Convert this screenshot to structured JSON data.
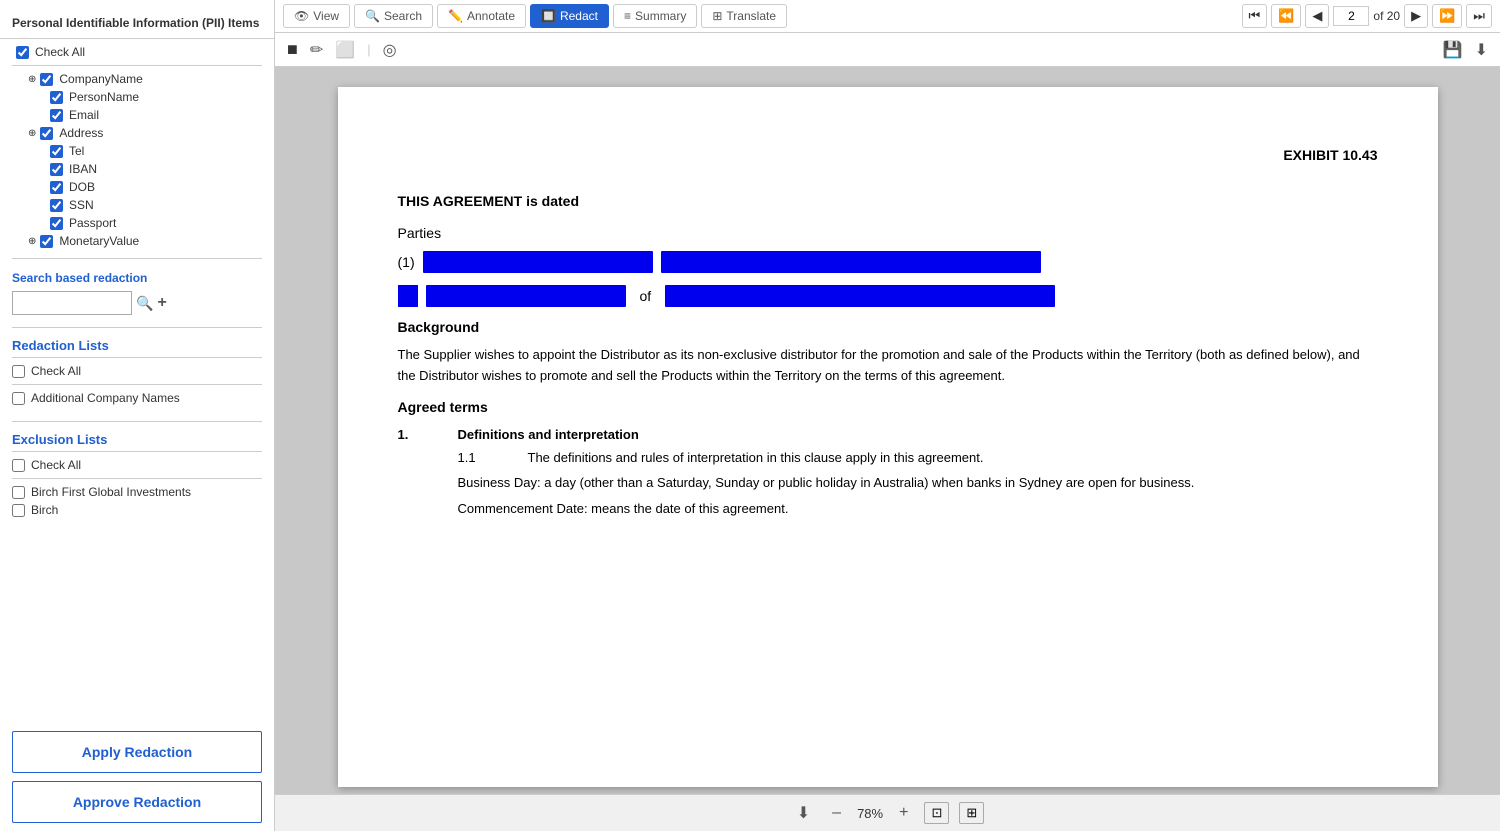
{
  "leftPanel": {
    "piiTitle": "Personal Identifiable Information (PII) Items",
    "checkAll": "Check All",
    "piiItems": [
      {
        "label": "CompanyName",
        "checked": true,
        "level": 1,
        "hasToggle": true
      },
      {
        "label": "PersonName",
        "checked": true,
        "level": 2,
        "hasToggle": false
      },
      {
        "label": "Email",
        "checked": true,
        "level": 2,
        "hasToggle": false
      },
      {
        "label": "Address",
        "checked": true,
        "level": 1,
        "hasToggle": true
      },
      {
        "label": "Tel",
        "checked": true,
        "level": 2,
        "hasToggle": false
      },
      {
        "label": "IBAN",
        "checked": true,
        "level": 2,
        "hasToggle": false
      },
      {
        "label": "DOB",
        "checked": true,
        "level": 2,
        "hasToggle": false
      },
      {
        "label": "SSN",
        "checked": true,
        "level": 2,
        "hasToggle": false
      },
      {
        "label": "Passport",
        "checked": true,
        "level": 2,
        "hasToggle": false
      },
      {
        "label": "MonetaryValue",
        "checked": true,
        "level": 1,
        "hasToggle": true
      }
    ],
    "searchRedactionLabel": "Search based redaction",
    "searchPlaceholder": "",
    "redactionListsTitle": "Redaction Lists",
    "redactionListCheckAll": "Check All",
    "redactionListItems": [
      {
        "label": "Additional Company Names",
        "checked": false
      }
    ],
    "exclusionListsTitle": "Exclusion Lists",
    "exclusionListCheckAll": "Check All",
    "exclusionListItems": [
      {
        "label": "Birch First Global Investments",
        "checked": false
      },
      {
        "label": "Birch",
        "checked": false
      }
    ],
    "applyRedactionBtn": "Apply Redaction",
    "approveRedactionBtn": "Approve Redaction"
  },
  "toolbar": {
    "tabs": [
      {
        "label": "View",
        "icon": "👁",
        "active": false
      },
      {
        "label": "Search",
        "icon": "🔍",
        "active": false
      },
      {
        "label": "Annotate",
        "icon": "✏️",
        "active": false
      },
      {
        "label": "Redact",
        "icon": "🔲",
        "active": true
      },
      {
        "label": "Summary",
        "icon": "≡",
        "active": false
      },
      {
        "label": "Translate",
        "icon": "⊞",
        "active": false
      }
    ],
    "pageInput": "2",
    "pageOf": "of 20"
  },
  "secondaryToolbar": {
    "tools": [
      "■",
      "✏",
      "⬜",
      "◎"
    ],
    "rightTools": [
      "💾",
      "⬇"
    ]
  },
  "document": {
    "exhibitLabel": "EXHIBIT 10.43",
    "agreementLine": "THIS AGREEMENT is dated",
    "partiesLabel": "Parties",
    "backgroundLabel": "Background",
    "backgroundText": "The Supplier wishes to appoint the Distributor as its non-exclusive distributor for the promotion and sale of the Products within the Territory (both as defined below), and the Distributor wishes to promote and sell the Products within the Territory on the terms of this agreement.",
    "agreedTermsLabel": "Agreed terms",
    "clause1Num": "1.",
    "clause1Title": "Definitions and interpretation",
    "subClause11Num": "1.1",
    "subClause11Text": "The definitions and rules of interpretation in this clause apply in this agreement.",
    "businessDayDef": "Business Day: a day (other than a Saturday, Sunday or public holiday in Australia) when banks in Sydney are open for business.",
    "commencementDef": "Commencement Date: means the date of this agreement."
  },
  "bottomBar": {
    "zoomIn": "+",
    "zoomOut": "–",
    "zoomLevel": "78%",
    "fitIcon": "⊡",
    "expandIcon": "⊞"
  }
}
